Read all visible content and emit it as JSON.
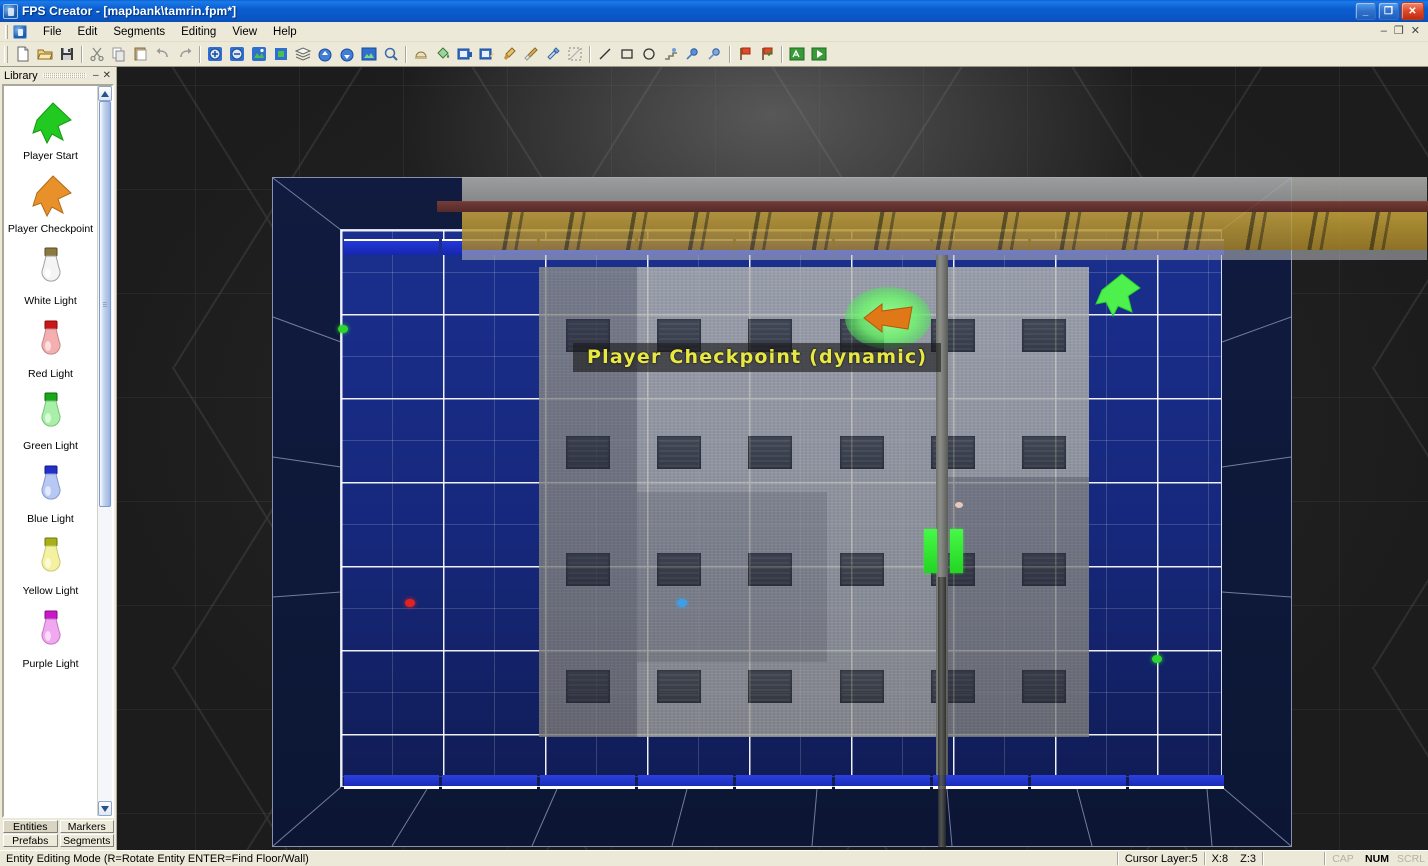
{
  "window": {
    "title": "FPS Creator  -  [mapbank\\tamrin.fpm*]",
    "minimize_label": "_",
    "maximize_label": "❐",
    "close_label": "✕",
    "mdi_minimize": "–",
    "mdi_restore": "❐",
    "mdi_close": "✕"
  },
  "menu": {
    "items": [
      {
        "label": "File"
      },
      {
        "label": "Edit"
      },
      {
        "label": "Segments"
      },
      {
        "label": "Editing"
      },
      {
        "label": "View"
      },
      {
        "label": "Help"
      }
    ]
  },
  "toolbar": {
    "groups": [
      {
        "buttons": [
          {
            "icon": "new-file-icon",
            "label": "New"
          },
          {
            "icon": "open-folder-icon",
            "label": "Open"
          },
          {
            "icon": "save-disk-icon",
            "label": "Save"
          }
        ]
      },
      {
        "buttons": [
          {
            "icon": "cut-scissors-icon",
            "label": "Cut"
          },
          {
            "icon": "copy-icon",
            "label": "Copy"
          },
          {
            "icon": "paste-icon",
            "label": "Paste"
          },
          {
            "icon": "undo-arrow-icon",
            "label": "Undo"
          },
          {
            "icon": "redo-arrow-icon",
            "label": "Redo"
          }
        ]
      },
      {
        "buttons": [
          {
            "icon": "zoom-in-icon",
            "label": "Zoom In"
          },
          {
            "icon": "zoom-out-icon",
            "label": "Zoom Out"
          },
          {
            "icon": "fit-view-icon",
            "label": "Fit View"
          },
          {
            "icon": "center-view-icon",
            "label": "Center View"
          },
          {
            "icon": "layers-icon",
            "label": "Layers"
          },
          {
            "icon": "layer-up-icon",
            "label": "Layer Up"
          },
          {
            "icon": "layer-down-icon",
            "label": "Layer Down"
          },
          {
            "icon": "picture-icon",
            "label": "Texture View"
          },
          {
            "icon": "magnifier-icon",
            "label": "Find"
          }
        ]
      },
      {
        "buttons": [
          {
            "icon": "light-dome-icon",
            "label": "Lightmap"
          },
          {
            "icon": "paint-bucket-icon",
            "label": "Fill"
          },
          {
            "icon": "add-room-icon",
            "label": "Add Room"
          },
          {
            "icon": "edit-room-icon",
            "label": "Edit Room"
          },
          {
            "icon": "paint-brush-icon",
            "label": "Paint"
          },
          {
            "icon": "brush-alt-icon",
            "label": "Brush"
          },
          {
            "icon": "eyedropper-icon",
            "label": "Pick"
          },
          {
            "icon": "marquee-select-icon",
            "label": "Select"
          }
        ]
      },
      {
        "buttons": [
          {
            "icon": "line-tool-icon",
            "label": "Line"
          },
          {
            "icon": "rectangle-tool-icon",
            "label": "Rectangle"
          },
          {
            "icon": "ellipse-tool-icon",
            "label": "Ellipse"
          },
          {
            "icon": "stairs-icon",
            "label": "Stairs"
          },
          {
            "icon": "entity-place-icon",
            "label": "Place Entity"
          },
          {
            "icon": "entity-alt-icon",
            "label": "Entity Tool"
          }
        ]
      },
      {
        "buttons": [
          {
            "icon": "flag-red-icon",
            "label": "Marker"
          },
          {
            "icon": "flag-check-icon",
            "label": "Checkpoint"
          }
        ]
      },
      {
        "buttons": [
          {
            "icon": "build-game-icon",
            "label": "Build Game"
          },
          {
            "icon": "test-game-icon",
            "label": "Test Game"
          }
        ]
      }
    ]
  },
  "library": {
    "title": "Library",
    "pin_label": "–",
    "close_label": "✕",
    "items": [
      {
        "label": "Player Start",
        "icon": "player-start-arrow-icon",
        "color": "#2fc92f"
      },
      {
        "label": "Player Checkpoint",
        "icon": "player-checkpoint-arrow-icon",
        "color": "#e8912a"
      },
      {
        "label": "White Light",
        "icon": "white-light-bulb-icon",
        "color": "#f2f2f2",
        "cap": "#8a7a42"
      },
      {
        "label": "Red Light",
        "icon": "red-light-bulb-icon",
        "color": "#f4a8a8",
        "cap": "#c81818"
      },
      {
        "label": "Green Light",
        "icon": "green-light-bulb-icon",
        "color": "#a8f0a8",
        "cap": "#18a818"
      },
      {
        "label": "Blue Light",
        "icon": "blue-light-bulb-icon",
        "color": "#aec4f2",
        "cap": "#2030c8"
      },
      {
        "label": "Yellow Light",
        "icon": "yellow-light-bulb-icon",
        "color": "#f4f2a0",
        "cap": "#a8b018"
      },
      {
        "label": "Purple Light",
        "icon": "purple-light-bulb-icon",
        "color": "#f0a8f0",
        "cap": "#c818c8"
      }
    ],
    "scroll_up_label": "▲",
    "scroll_down_label": "▼",
    "tabs": [
      {
        "label": "Entities",
        "active": true
      },
      {
        "label": "Markers",
        "active": false
      },
      {
        "label": "Prefabs",
        "active": false
      },
      {
        "label": "Segments",
        "active": false
      }
    ]
  },
  "viewport": {
    "tooltip": "Player Checkpoint (dynamic)",
    "entities": [
      {
        "name": "player-checkpoint-entity",
        "type": "checkpoint",
        "selected": true
      },
      {
        "name": "player-start-entity",
        "type": "start",
        "selected": false
      },
      {
        "name": "green-light-marker-left",
        "type": "green-light"
      },
      {
        "name": "green-light-marker-right",
        "type": "green-light"
      },
      {
        "name": "red-light-marker",
        "type": "red-light"
      },
      {
        "name": "blue-light-marker",
        "type": "blue-light"
      },
      {
        "name": "door-marker-left",
        "type": "door"
      },
      {
        "name": "door-marker-right",
        "type": "door"
      }
    ],
    "colors": {
      "floor_blue": "#16287c",
      "grid_white": "#ffffff",
      "facade_gray": "#aeafaa",
      "cornice_gold": "#b89532",
      "tooltip_text": "#e8e840",
      "select_glow": "#6ef56e"
    }
  },
  "status": {
    "mode_text": "Entity Editing Mode (R=Rotate Entity  ENTER=Find Floor/Wall)",
    "cursor_layer": "Cursor Layer:5",
    "coord_x": "X:8",
    "coord_z": "Z:3",
    "caps": "CAP",
    "num": "NUM",
    "scroll": "SCRL"
  }
}
